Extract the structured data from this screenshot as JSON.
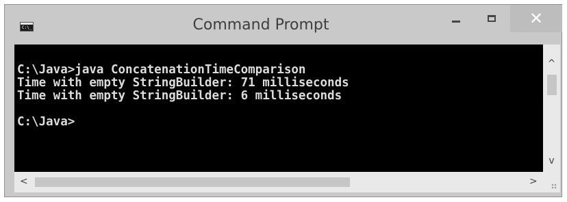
{
  "window": {
    "title": "Command Prompt",
    "icon_label": "C:\\_"
  },
  "console": {
    "lines": [
      "C:\\Java>java ConcatenationTimeComparison",
      "Time with empty StringBuilder: 71 milliseconds",
      "Time with empty StringBuilder: 6 milliseconds",
      "",
      "C:\\Java>"
    ]
  },
  "controls": {
    "minimize_icon": "minimize-icon",
    "maximize_icon": "maximize-icon",
    "close_icon": "close-icon",
    "close_glyph": "✕"
  },
  "scrollbars": {
    "up_glyph": "^",
    "down_glyph": "v",
    "left_glyph": "<",
    "right_glyph": ">"
  },
  "colors": {
    "console_bg": "#000000",
    "console_fg": "#dcdcdc",
    "chrome": "#c9c9c9"
  }
}
